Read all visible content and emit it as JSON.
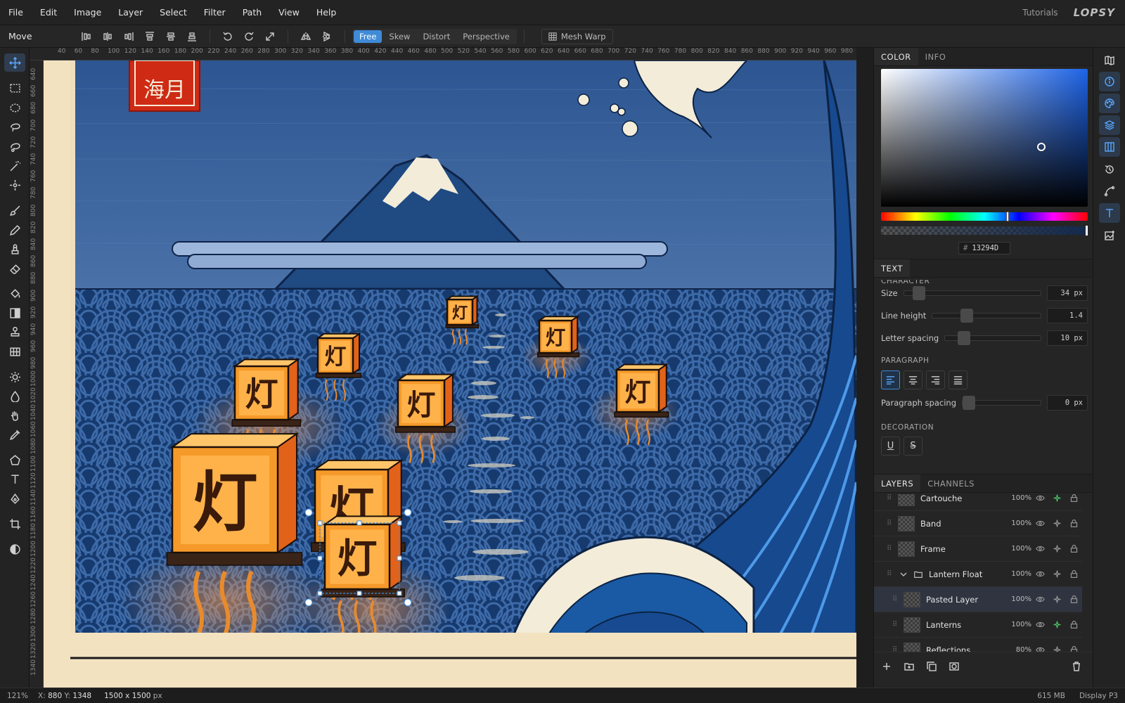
{
  "menu": [
    "File",
    "Edit",
    "Image",
    "Layer",
    "Select",
    "Filter",
    "Path",
    "View",
    "Help"
  ],
  "header": {
    "tutorials": "Tutorials",
    "logo": "LOPSY"
  },
  "options": {
    "tool_name": "Move",
    "modes": [
      "Free",
      "Skew",
      "Distort",
      "Perspective"
    ],
    "active_mode": "Free",
    "mesh_warp": "Mesh Warp"
  },
  "rulers": {
    "top": [
      "40",
      "60",
      "80",
      "100",
      "120",
      "140",
      "160",
      "180",
      "200",
      "220",
      "240",
      "260",
      "280",
      "300",
      "320",
      "340",
      "360",
      "380",
      "400",
      "420",
      "440",
      "460",
      "480",
      "500",
      "520",
      "540",
      "560",
      "580",
      "600",
      "620",
      "640",
      "660",
      "680",
      "700",
      "720",
      "740",
      "760",
      "780",
      "800",
      "820",
      "840",
      "860",
      "880",
      "900",
      "920",
      "940",
      "960",
      "980"
    ],
    "left": [
      "640",
      "660",
      "680",
      "700",
      "720",
      "740",
      "760",
      "780",
      "800",
      "820",
      "840",
      "860",
      "880",
      "900",
      "920",
      "940",
      "960",
      "980",
      "1000",
      "1020",
      "1040",
      "1060",
      "1080",
      "1100",
      "1120",
      "1140",
      "1160",
      "1180",
      "1200",
      "1220",
      "1240",
      "1260",
      "1280",
      "1300",
      "1320",
      "1340"
    ]
  },
  "canvas": {
    "cartouche_text": "海月",
    "lantern_glyph": "灯",
    "colors": {
      "sky": "#36609a",
      "sea": "#163a6e",
      "lantern": "#f59a2a",
      "wave_light": "#f3ecd9",
      "accent": "#3f8bd8"
    }
  },
  "status": {
    "zoom": "121%",
    "x_label": "X:",
    "x": "880",
    "y_label": "Y:",
    "y": "1348",
    "doc_size": "1500 x 1500",
    "doc_unit": "px",
    "memory": "615 MB",
    "profile": "Display P3"
  },
  "color_panel": {
    "tabs": [
      "COLOR",
      "INFO"
    ],
    "hex_label": "#",
    "hex": "13294D",
    "current_color": "#13294d"
  },
  "text_panel": {
    "tab": "TEXT",
    "character_heading": "CHARACTER",
    "size_label": "Size",
    "size_value": "34 px",
    "line_height_label": "Line height",
    "line_height_value": "1.4",
    "letter_spacing_label": "Letter spacing",
    "letter_spacing_value": "10 px",
    "paragraph_heading": "PARAGRAPH",
    "paragraph_spacing_label": "Paragraph spacing",
    "paragraph_spacing_value": "0 px",
    "decoration_heading": "DECORATION",
    "underline": "U",
    "strikethrough": "S"
  },
  "layers_panel": {
    "tabs": [
      "LAYERS",
      "CHANNELS"
    ],
    "layers": [
      {
        "name": "Cartouche",
        "opacity": "100%",
        "fx": true
      },
      {
        "name": "Band",
        "opacity": "100%",
        "fx": false
      },
      {
        "name": "Frame",
        "opacity": "100%",
        "fx": false
      },
      {
        "name": "Lantern Float",
        "opacity": "100%",
        "fx": false,
        "group": true
      },
      {
        "name": "Pasted Layer",
        "opacity": "100%",
        "fx": false,
        "selected": true
      },
      {
        "name": "Lanterns",
        "opacity": "100%",
        "fx": true
      },
      {
        "name": "Reflections",
        "opacity": "80%",
        "fx": false
      }
    ]
  }
}
